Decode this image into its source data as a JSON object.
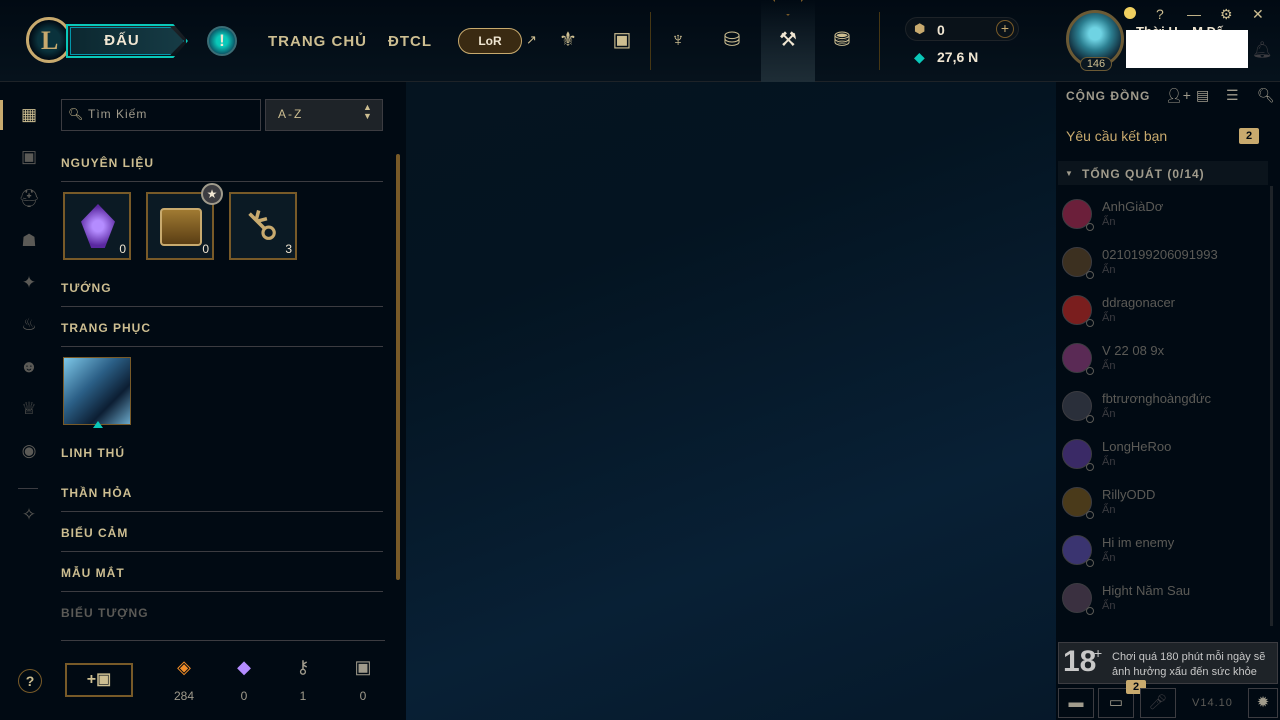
{
  "topbar": {
    "play_label": "ĐẤU",
    "alert_icon": "!",
    "nav_home": "TRANG CHỦ",
    "nav_tft": "ĐTCL",
    "lor_label": "LoR",
    "rp": "0",
    "be": "27,6 N",
    "level": "146",
    "summoner_name": "Thời H... M Đế"
  },
  "sidebar": {
    "icons": [
      "grid-icon",
      "collection-icon",
      "helmet-icon",
      "mask-icon",
      "spell-icon",
      "ward-icon",
      "emote-icon",
      "companion-icon",
      "profile-icon",
      "tft-icon"
    ]
  },
  "collection": {
    "search_placeholder": "Tìm Kiếm",
    "sort_value": "A-Z",
    "categories": {
      "materials": "NGUYÊN LIỆU",
      "champions": "TƯỚNG",
      "skins": "TRANG PHỤC",
      "companions": "LINH THÚ",
      "wards": "THẦN HỎA",
      "emotes": "BIỂU CẢM",
      "eyes": "MẪU MẮT",
      "icons": "BIỂU TƯỢNG"
    },
    "materials": [
      {
        "name": "mythic-essence-icon",
        "count": "0"
      },
      {
        "name": "chest-icon",
        "count": "0"
      },
      {
        "name": "key-icon",
        "count": "3"
      }
    ],
    "currencies": [
      {
        "name": "orange-essence-icon",
        "value": "284",
        "color": "#f08c28"
      },
      {
        "name": "mythic-essence-icon",
        "value": "0",
        "color": "#b48cff"
      },
      {
        "name": "key-fragment-icon",
        "value": "1",
        "color": "#a09b8c"
      },
      {
        "name": "token-icon",
        "value": "0",
        "color": "#a09b8c"
      }
    ]
  },
  "social": {
    "title": "CỘNG ĐỒNG",
    "friend_requests": "Yêu cầu kết bạn",
    "friend_requests_count": "2",
    "group_label": "TỔNG QUÁT (0/14)",
    "friends": [
      {
        "name": "AnhGiàDơ",
        "status": "Ẩn",
        "color": "#6b1f3a"
      },
      {
        "name": "0210199206091993",
        "status": "Ẩn",
        "color": "#3c3020"
      },
      {
        "name": "ddragonacer",
        "status": "Ẩn",
        "color": "#7a1e1e"
      },
      {
        "name": "V 22 08 9x",
        "status": "Ẩn",
        "color": "#5a2a55"
      },
      {
        "name": "fbtrươnghoàngđức",
        "status": "Ẩn",
        "color": "#2a2f3a"
      },
      {
        "name": "LongHeRoo",
        "status": "Ẩn",
        "color": "#3a2a66"
      },
      {
        "name": "RillyODD",
        "status": "Ẩn",
        "color": "#4a3a1a"
      },
      {
        "name": "Hi im enemy",
        "status": "Ẩn",
        "color": "#3a3470"
      },
      {
        "name": "Hight Năm Sau",
        "status": "Ẩn",
        "color": "#3a3040"
      }
    ],
    "age_rating": "18",
    "age_plus": "+",
    "age_warning": "Chơi quá 180 phút mỗi ngày sẽ ảnh hưởng xấu đến sức khỏe",
    "chat_badge": "2",
    "version": "V14.10"
  }
}
